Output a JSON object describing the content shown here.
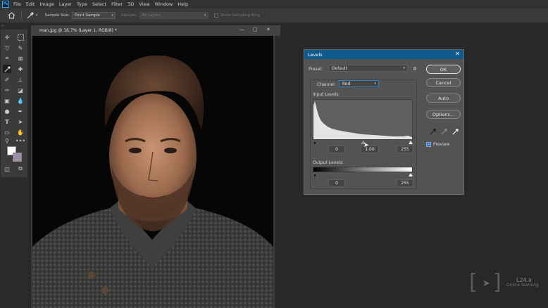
{
  "app": {
    "logo": "Ps",
    "menu": [
      "File",
      "Edit",
      "Image",
      "Layer",
      "Type",
      "Select",
      "Filter",
      "3D",
      "View",
      "Window",
      "Help"
    ]
  },
  "options_bar": {
    "sample_size_label": "Sample Size:",
    "sample_size_value": "Point Sample",
    "sample_label": "Sample:",
    "sample_value": "All Layers",
    "show_ring_label": "Show Sampling Ring"
  },
  "toolbar": {
    "icons": [
      "move-icon",
      "marquee-icon",
      "lasso-icon",
      "quick-select-icon",
      "crop-icon",
      "frame-icon",
      "eyedropper-icon",
      "healing-icon",
      "brush-icon",
      "stamp-icon",
      "history-brush-icon",
      "eraser-icon",
      "gradient-icon",
      "blur-icon",
      "dodge-icon",
      "pen-icon",
      "type-icon",
      "path-select-icon",
      "rectangle-icon",
      "hand-icon",
      "zoom-icon",
      "more-icon"
    ],
    "foreground_color": "#ffffff",
    "background_color": "#9a8fa3"
  },
  "document": {
    "tab_title": "man.jpg @ 16.7% (Layer 1, RGB/8) *"
  },
  "levels": {
    "title": "Levels",
    "preset_label": "Preset:",
    "preset_value": "Default",
    "channel_label": "Channel:",
    "channel_value": "Red",
    "input_levels_label": "Input Levels:",
    "input_black": "0",
    "input_gamma": "1.00",
    "input_white": "255",
    "output_levels_label": "Output Levels:",
    "output_black": "0",
    "output_white": "255",
    "ok_label": "OK",
    "cancel_label": "Cancel",
    "auto_label": "Auto",
    "options_label": "Options...",
    "preview_label": "Preview",
    "preview_checked": true
  },
  "watermark": {
    "site": "L24.ir",
    "tagline": "Online learning"
  }
}
